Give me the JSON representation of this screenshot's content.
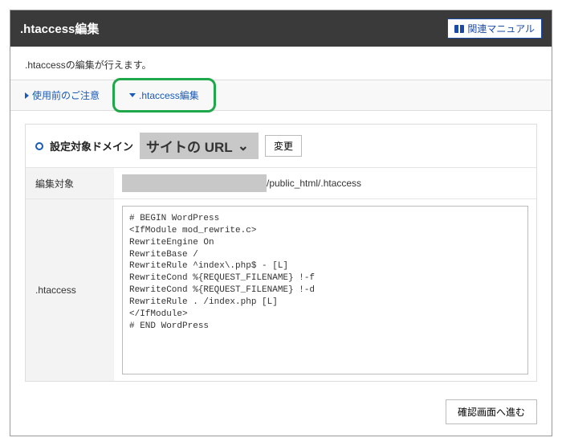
{
  "header": {
    "title": ".htaccess編集",
    "manual_button": "関連マニュアル"
  },
  "intro_text": ".htaccessの編集が行えます。",
  "tabs": [
    {
      "label": "使用前のご注意",
      "open": false
    },
    {
      "label": ".htaccess編集",
      "open": true
    }
  ],
  "panel": {
    "domain_label": "設定対象ドメイン",
    "domain_value": "サイトの URL",
    "change_button": "変更"
  },
  "rows": {
    "edit_target_label": "編集対象",
    "edit_target_path": "/public_html/.htaccess",
    "htaccess_label": ".htaccess",
    "htaccess_content": "# BEGIN WordPress\n<IfModule mod_rewrite.c>\nRewriteEngine On\nRewriteBase /\nRewriteRule ^index\\.php$ - [L]\nRewriteCond %{REQUEST_FILENAME} !-f\nRewriteCond %{REQUEST_FILENAME} !-d\nRewriteRule . /index.php [L]\n</IfModule>\n# END WordPress"
  },
  "footer": {
    "proceed_button": "確認画面へ進む"
  }
}
